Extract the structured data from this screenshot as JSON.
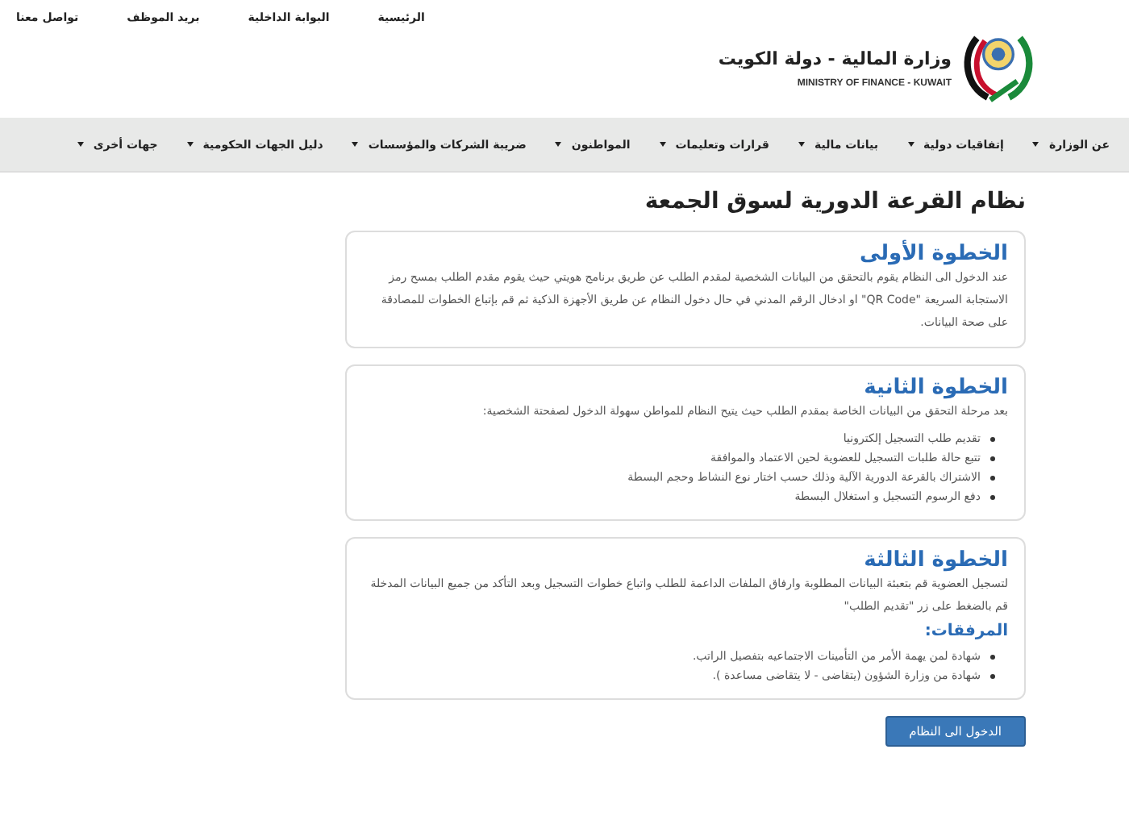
{
  "top_links": [
    "الرئيسية",
    "البوابة الداخلية",
    "بريد الموظف",
    "تواصل معنا"
  ],
  "logo": {
    "title": "وزارة المالية - دولة الكويت",
    "subtitle": "MINISTRY OF FINANCE - KUWAIT"
  },
  "nav": [
    "عن الوزارة",
    "إتفاقيات دولية",
    "بيانات مالية",
    "قرارات وتعليمات",
    "المواطنون",
    "ضريبة الشركات والمؤسسات",
    "دليل الجهات الحكومية",
    "جهات أخرى"
  ],
  "page_title": "نظام القرعة الدورية لسوق الجمعة",
  "steps": [
    {
      "title": "الخطوة الأولى",
      "text": "عند الدخول الى النظام يقوم بالتحقق من البيانات الشخصية لمقدم الطلب عن طريق برنامج هويتي حيث يقوم مقدم الطلب بمسح رمز الاستجابة السريعة \"QR Code\" او ادخال الرقم المدني في حال دخول النظام عن طريق الأجهزة الذكية ثم قم بإتباع الخطوات للمصادقة على صحة البيانات."
    },
    {
      "title": "الخطوة الثانية",
      "text": "بعد مرحلة التحقق من البيانات الخاصة بمقدم الطلب حيث يتيح النظام للمواطن سهولة الدخول لصفحتة الشخصية:",
      "bullets": [
        "تقديم طلب التسجيل إلكترونيا",
        "تتبع حالة طلبات التسجيل للعضوية لحين الاعتماد والموافقة",
        "الاشتراك بالقرعة الدورية الآلية وذلك حسب اختار نوع النشاط وحجم البسطة",
        "دفع الرسوم التسجيل و استغلال البسطة"
      ]
    },
    {
      "title": "الخطوة الثالثة",
      "text": "لتسجيل العضوية قم بتعبئة البيانات المطلوبة وارفاق الملفات الداعمة للطلب واتباع خطوات التسجيل وبعد التأكد من جميع البيانات المدخلة قم بالضغط على زر \"تقديم الطلب\"",
      "attachments": {
        "heading": "المرفقات:",
        "items": [
          "شهادة لمن يهمة الأمر من التأمينات الاجتماعيه بتفصيل الراتب.",
          "شهادة من وزارة الشؤون (يتقاضى - لا يتقاضى مساعدة )."
        ]
      }
    }
  ],
  "enter_button": "الدخول الى النظام"
}
